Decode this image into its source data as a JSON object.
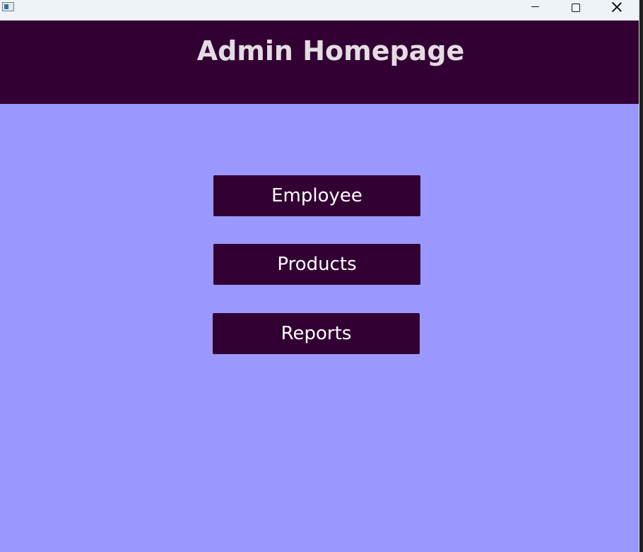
{
  "window": {
    "title": "",
    "icon": "app-window-icon",
    "controls": {
      "minimize_icon": "minimize-icon",
      "maximize_icon": "maximize-icon",
      "close_icon": "close-icon"
    }
  },
  "header": {
    "title": "Admin Homepage"
  },
  "buttons": [
    {
      "label": "Employee"
    },
    {
      "label": "Products"
    },
    {
      "label": "Reports"
    }
  ],
  "colors": {
    "header_background": "#330033",
    "content_background": "#9a98fe",
    "button_background": "#330033",
    "button_text": "#ffffff",
    "title_text": "#e3dce3"
  }
}
